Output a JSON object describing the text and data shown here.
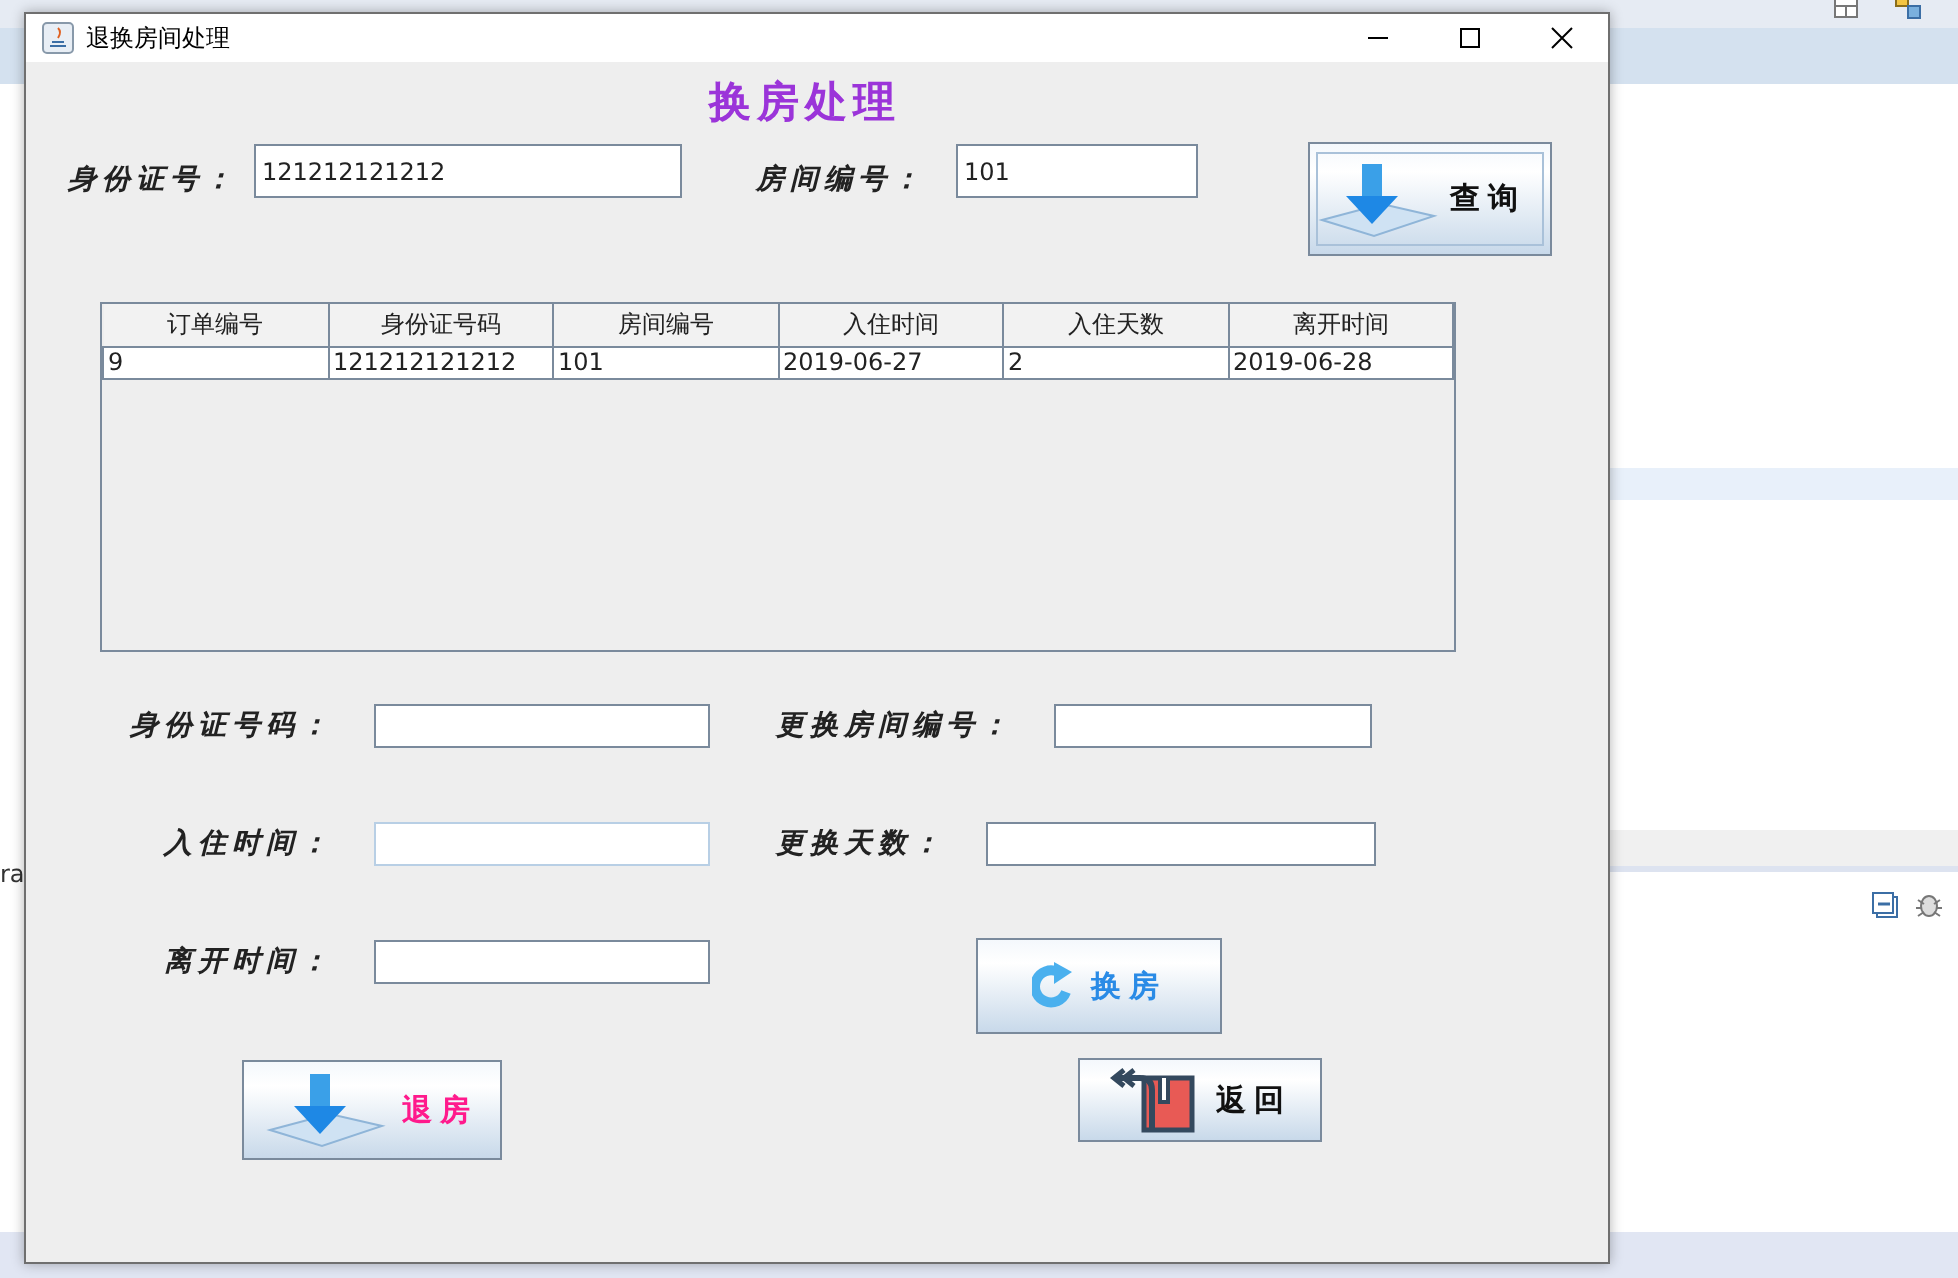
{
  "background": {
    "texts": [
      {
        "kind": "side",
        "text": "ra"
      }
    ]
  },
  "window": {
    "title": "退换房间处理"
  },
  "heading": "换房处理",
  "search": {
    "id_label": "身份证号：",
    "id_value": "121212121212",
    "room_label": "房间编号：",
    "room_value": "101",
    "button": {
      "label": "查询",
      "color": "#111111"
    }
  },
  "table": {
    "columns": [
      "订单编号",
      "身份证号码",
      "房间编号",
      "入住时间",
      "入住天数",
      "离开时间"
    ],
    "rows": [
      [
        "9",
        "121212121212",
        "101",
        "2019-06-27",
        "2",
        "2019-06-28"
      ]
    ]
  },
  "form": {
    "left": [
      {
        "label": "身份证号码：",
        "focused": false
      },
      {
        "label": "入住时间：",
        "focused": true
      },
      {
        "label": "离开时间：",
        "focused": false
      }
    ],
    "right": [
      {
        "label": "更换房间编号：",
        "focused": false
      },
      {
        "label": "更换天数：",
        "focused": false
      }
    ]
  },
  "actions": [
    {
      "kind": "swap",
      "label": "换房",
      "color": "#2a8be6"
    },
    {
      "kind": "checkout",
      "label": "退房",
      "color": "#ff1a8c"
    },
    {
      "kind": "back",
      "label": "返回",
      "color": "#111111"
    }
  ]
}
